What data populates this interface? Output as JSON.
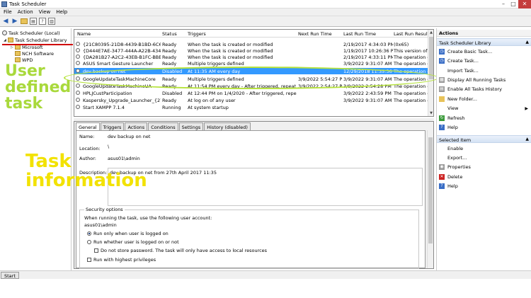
{
  "window": {
    "title": "Task Scheduler"
  },
  "menu": [
    "File",
    "Action",
    "View",
    "Help"
  ],
  "tree": {
    "items": [
      {
        "label": "Task Scheduler (Local)"
      },
      {
        "label": "Task Scheduler Library"
      },
      {
        "label": "Microsoft"
      },
      {
        "label": "NCH Software"
      },
      {
        "label": "WPD"
      }
    ]
  },
  "annotations": {
    "green": [
      "User",
      "defined",
      "task"
    ],
    "yellow": [
      "Task",
      "information"
    ]
  },
  "tasklist": {
    "columns": [
      "Name",
      "Status",
      "Triggers",
      "Next Run Time",
      "Last Run Time",
      "Last Run Result"
    ],
    "rows": [
      {
        "name": "{21C80395-21D8-4439-B1BD-6C68C...",
        "status": "Ready",
        "triggers": "When the task is created or modified",
        "next": "",
        "last": "2/19/2017 4:34:03 PM",
        "result": "(0x65)"
      },
      {
        "name": "{D444E7AE-3477-444A-A22B-4343B...",
        "status": "Ready",
        "triggers": "When the task is created or modified",
        "next": "",
        "last": "1/19/2017 10:26:36 P...",
        "result": "This version of"
      },
      {
        "name": "{DA281B27-A2C2-43EB-B1FC-BBE8...",
        "status": "Ready",
        "triggers": "When the task is created or modified",
        "next": "",
        "last": "2/19/2017 4:33:11 PM",
        "result": "The operation c"
      },
      {
        "name": "ASUS Smart Gesture Launcher",
        "status": "Ready",
        "triggers": "Multiple triggers defined",
        "next": "",
        "last": "3/9/2022 9:31:07 AM",
        "result": "The operation c"
      },
      {
        "name": "dev backup on net",
        "status": "Disabled",
        "triggers": "At 11:35 AM every day",
        "next": "",
        "last": "12/29/2018 11:35:36 ...",
        "result": "The operation c"
      },
      {
        "name": "GoogleUpdateTaskMachineCore",
        "status": "Ready",
        "triggers": "Multiple triggers defined",
        "next": "3/9/2022 5:54:27 PM",
        "last": "3/9/2022 9:31:07 AM",
        "result": "The operation c"
      },
      {
        "name": "GoogleUpdateTaskMachineUA",
        "status": "Ready",
        "triggers": "At 11:54 PM every day - After triggered, repeat ...",
        "next": "3/9/2022 2:54:27 PM",
        "last": "3/9/2022 2:54:28 PM",
        "result": "The operation c"
      },
      {
        "name": "HPLJCustParticipation",
        "status": "Disabled",
        "triggers": "At 12:44 PM on 1/4/2020 - After triggered, repeat ...",
        "next": "",
        "last": "3/9/2022 2:43:59 PM",
        "result": "The operation c"
      },
      {
        "name": "Kaspersky_Upgrade_Launcher_{278...",
        "status": "Ready",
        "triggers": "At log on of any user",
        "next": "",
        "last": "3/9/2022 9:31:07 AM",
        "result": "The operation c"
      },
      {
        "name": "Start XAMPP 7.1.4",
        "status": "Running",
        "triggers": "At system startup",
        "next": "",
        "last": "",
        "result": ""
      }
    ]
  },
  "detail": {
    "tabs": [
      "General",
      "Triggers",
      "Actions",
      "Conditions",
      "Settings",
      "History (disabled)"
    ],
    "name_label": "Name:",
    "name_value": "dev backup on net",
    "location_label": "Location:",
    "location_value": "\\",
    "author_label": "Author:",
    "author_value": "asus01\\admin",
    "description_label": "Description:",
    "description_value": "dev backup on net from 27th April 2017 11:35",
    "security": {
      "title": "Security options",
      "account_prompt": "When running the task, use the following user account:",
      "account": "asus01\\admin",
      "opt_logged_on": "Run only when user is logged on",
      "opt_whether": "Run whether user is logged on or not",
      "opt_no_password": "Do not store password.  The task will only have access to local resources",
      "opt_highest": "Run with highest privileges"
    }
  },
  "actions": {
    "header": "Actions",
    "library_section": "Task Scheduler Library",
    "library_items": [
      {
        "label": "Create Basic Task...",
        "icon": "create-basic-task-icon"
      },
      {
        "label": "Create Task...",
        "icon": "create-task-icon"
      },
      {
        "label": "Import Task...",
        "icon": "import-icon"
      },
      {
        "label": "Display All Running Tasks",
        "icon": "running-tasks-icon"
      },
      {
        "label": "Enable All Tasks History",
        "icon": "history-icon"
      },
      {
        "label": "New Folder...",
        "icon": "folder-icon"
      },
      {
        "label": "View",
        "icon": "view-icon"
      },
      {
        "label": "Refresh",
        "icon": "refresh-icon"
      },
      {
        "label": "Help",
        "icon": "help-icon"
      }
    ],
    "selected_section": "Selected Item",
    "selected_items": [
      {
        "label": "Enable",
        "icon": "enable-icon"
      },
      {
        "label": "Export...",
        "icon": "export-icon"
      },
      {
        "label": "Properties",
        "icon": "properties-icon"
      },
      {
        "label": "Delete",
        "icon": "delete-icon"
      },
      {
        "label": "Help",
        "icon": "help-icon"
      }
    ]
  },
  "statusbar": {
    "start_label": "Start"
  },
  "colors": {
    "selection": "#3399ff",
    "annotation_green": "#a9d93c",
    "annotation_yellow": "#f2e200",
    "underline_red": "#d00000"
  }
}
